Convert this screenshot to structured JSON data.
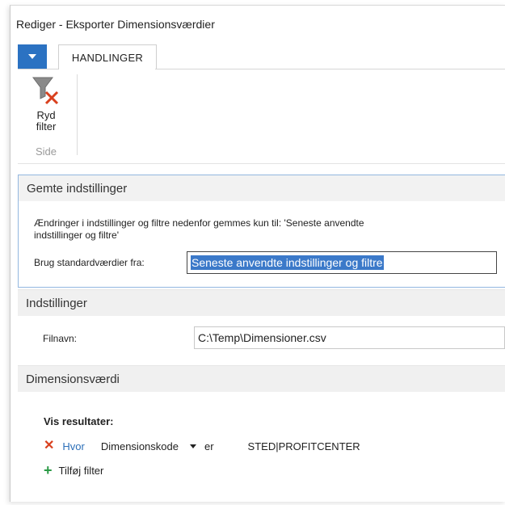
{
  "window": {
    "title": "Rediger - Eksporter Dimensionsværdier"
  },
  "ribbon": {
    "tab_label": "HANDLINGER",
    "clear_filter": {
      "label_line1": "Ryd",
      "label_line2": "filter",
      "icon": "filter-clear-icon"
    },
    "group_label": "Side"
  },
  "saved_settings": {
    "header": "Gemte indstillinger",
    "note": "Ændringer i indstillinger og filtre nedenfor gemmes kun til: 'Seneste anvendte indstillinger og filtre'",
    "default_label": "Brug standardværdier fra:",
    "default_value": "Seneste anvendte indstillinger og filtre"
  },
  "options": {
    "header": "Indstillinger",
    "filename_label": "Filnavn:",
    "filename_value": "C:\\Temp\\Dimensioner.csv"
  },
  "dimension_value": {
    "header": "Dimensionsværdi",
    "show_results_label": "Vis resultater:",
    "filter": {
      "remove_icon": "close-icon",
      "where": "Hvor",
      "field": "Dimensionskode",
      "operator": "er",
      "value": "STED|PROFITCENTER"
    },
    "add_filter_label": "Tilføj filter",
    "add_icon": "plus-icon"
  },
  "colors": {
    "accent": "#2b72c2",
    "selection": "#3b79c9",
    "remove": "#d9401e",
    "add": "#2b9a46"
  }
}
